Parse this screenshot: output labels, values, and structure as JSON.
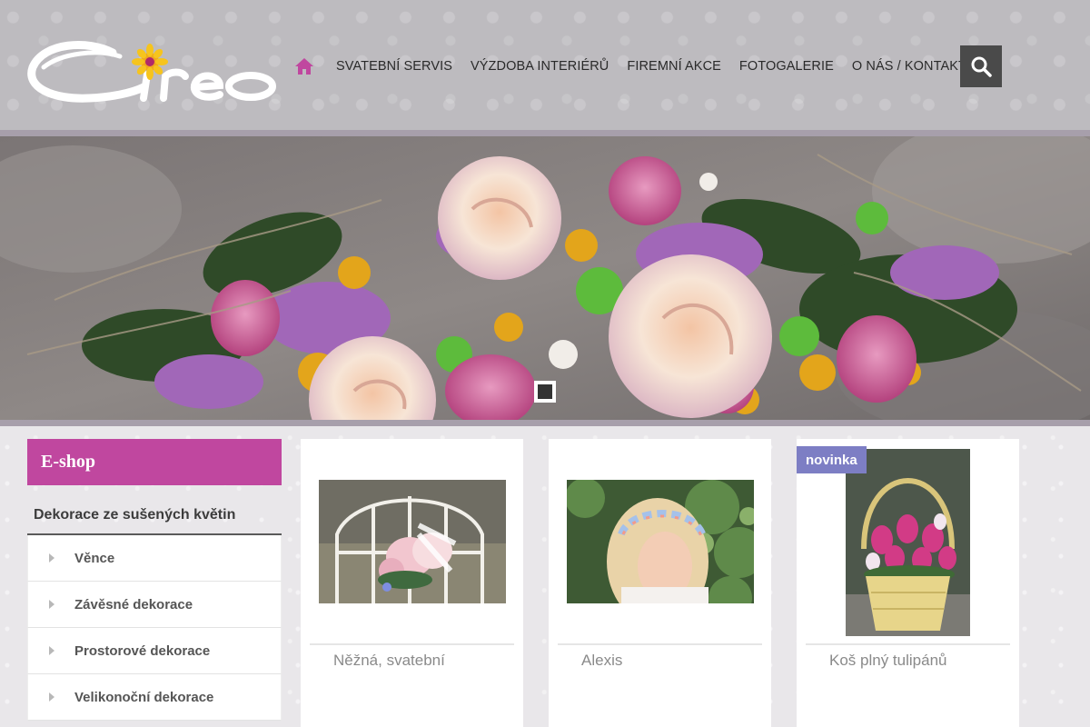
{
  "brand": {
    "logo_text": "Cireo"
  },
  "colors": {
    "accent": "#c0479f",
    "badge": "#7d7ec4",
    "header": "#bdbbbf",
    "stripe": "#a79fab"
  },
  "nav": {
    "home_icon": "home-icon",
    "items": [
      {
        "label": "SVATEBNÍ SERVIS"
      },
      {
        "label": "VÝZDOBA INTERIÉRŮ"
      },
      {
        "label": "FIREMNÍ AKCE"
      },
      {
        "label": "FOTOGALERIE"
      },
      {
        "label": "O NÁS / KONTAKT"
      }
    ],
    "search_icon": "search-icon"
  },
  "sidebar": {
    "title": "E-shop",
    "heading": "Dekorace ze sušených květin",
    "items": [
      {
        "label": "Věnce"
      },
      {
        "label": "Závěsné dekorace"
      },
      {
        "label": "Prostorové dekorace"
      },
      {
        "label": "Velikonoční dekorace"
      }
    ]
  },
  "products": [
    {
      "name": "Něžná, svatební",
      "badge": ""
    },
    {
      "name": "Alexis",
      "badge": ""
    },
    {
      "name": "Koš plný tulipánů",
      "badge": "novinka"
    }
  ]
}
